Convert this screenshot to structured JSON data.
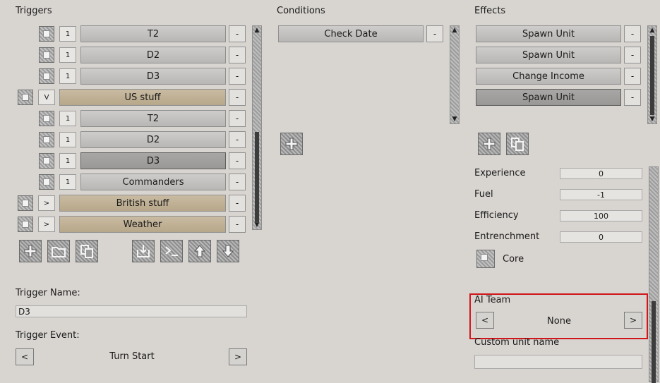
{
  "headers": {
    "triggers": "Triggers",
    "conditions": "Conditions",
    "effects": "Effects"
  },
  "triggers": [
    {
      "indent": 1,
      "num": "1",
      "label": "T2",
      "style": "gray"
    },
    {
      "indent": 1,
      "num": "1",
      "label": "D2",
      "style": "gray"
    },
    {
      "indent": 1,
      "num": "1",
      "label": "D3",
      "style": "gray"
    },
    {
      "indent": 0,
      "num": "V",
      "label": "US stuff",
      "style": "tan"
    },
    {
      "indent": 1,
      "num": "1",
      "label": "T2",
      "style": "gray"
    },
    {
      "indent": 1,
      "num": "1",
      "label": "D2",
      "style": "gray"
    },
    {
      "indent": 1,
      "num": "1",
      "label": "D3",
      "style": "selected"
    },
    {
      "indent": 1,
      "num": "1",
      "label": "Commanders",
      "style": "gray"
    },
    {
      "indent": 0,
      "num": ">",
      "label": "British stuff",
      "style": "tan"
    },
    {
      "indent": 0,
      "num": ">",
      "label": "Weather",
      "style": "tan"
    }
  ],
  "remove_label": "-",
  "conditions": [
    {
      "label": "Check Date"
    }
  ],
  "effects": [
    {
      "label": "Spawn Unit",
      "style": "gray"
    },
    {
      "label": "Spawn Unit",
      "style": "gray"
    },
    {
      "label": "Change Income",
      "style": "gray"
    },
    {
      "label": "Spawn Unit",
      "style": "selected"
    }
  ],
  "params": [
    {
      "label": "Experience",
      "value": "0"
    },
    {
      "label": "Fuel",
      "value": "-1"
    },
    {
      "label": "Efficiency",
      "value": "100"
    },
    {
      "label": "Entrenchment",
      "value": "0"
    }
  ],
  "core_label": "Core",
  "ai_team": {
    "label": "AI Team",
    "value": "None",
    "prev": "<",
    "next": ">"
  },
  "custom_unit_name": {
    "label": "Custom unit name",
    "value": ""
  },
  "trigger_name": {
    "label": "Trigger Name:",
    "value": "D3"
  },
  "trigger_event": {
    "label": "Trigger Event:",
    "value": "Turn Start",
    "prev": "<",
    "next": ">"
  },
  "icons": [
    "plus-icon",
    "folder-icon",
    "copy-icon",
    "import-icon",
    "console-icon",
    "up-arrow-icon",
    "down-arrow-icon"
  ],
  "colors": {
    "background": "#d8d5d1",
    "tan": "#c9bba2",
    "highlight": "#d0161a"
  }
}
